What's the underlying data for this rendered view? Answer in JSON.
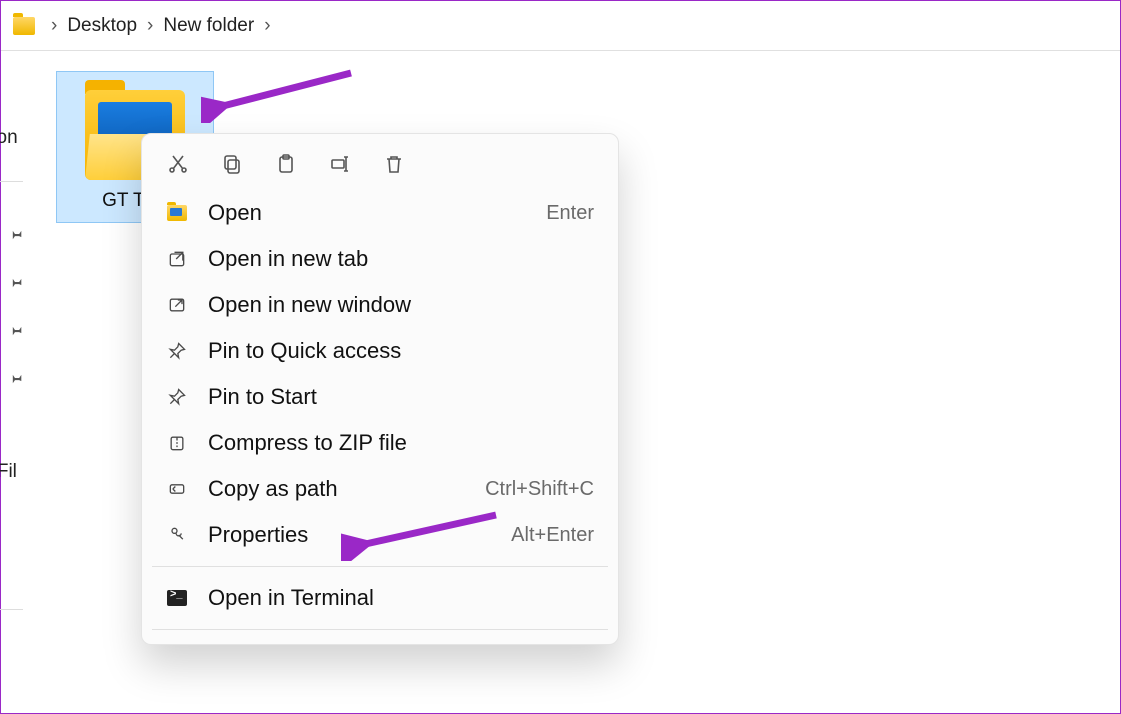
{
  "breadcrumb": {
    "items": [
      "Desktop",
      "New folder"
    ]
  },
  "sidebar": {
    "label_top": "son",
    "label_mid": "e Fil"
  },
  "folder": {
    "name": "GT Test"
  },
  "context_menu": {
    "toolbar": [
      "cut",
      "copy",
      "paste",
      "rename",
      "delete"
    ],
    "items": [
      {
        "icon": "folder",
        "label": "Open",
        "accel": "Enter"
      },
      {
        "icon": "new-tab",
        "label": "Open in new tab",
        "accel": ""
      },
      {
        "icon": "new-window",
        "label": "Open in new window",
        "accel": ""
      },
      {
        "icon": "pin",
        "label": "Pin to Quick access",
        "accel": ""
      },
      {
        "icon": "pin",
        "label": "Pin to Start",
        "accel": ""
      },
      {
        "icon": "zip",
        "label": "Compress to ZIP file",
        "accel": ""
      },
      {
        "icon": "copy-path",
        "label": "Copy as path",
        "accel": "Ctrl+Shift+C"
      },
      {
        "icon": "properties",
        "label": "Properties",
        "accel": "Alt+Enter"
      }
    ],
    "terminal": {
      "label": "Open in Terminal"
    }
  },
  "colors": {
    "highlight": "#cce8ff",
    "arrow": "#9a28c7"
  }
}
